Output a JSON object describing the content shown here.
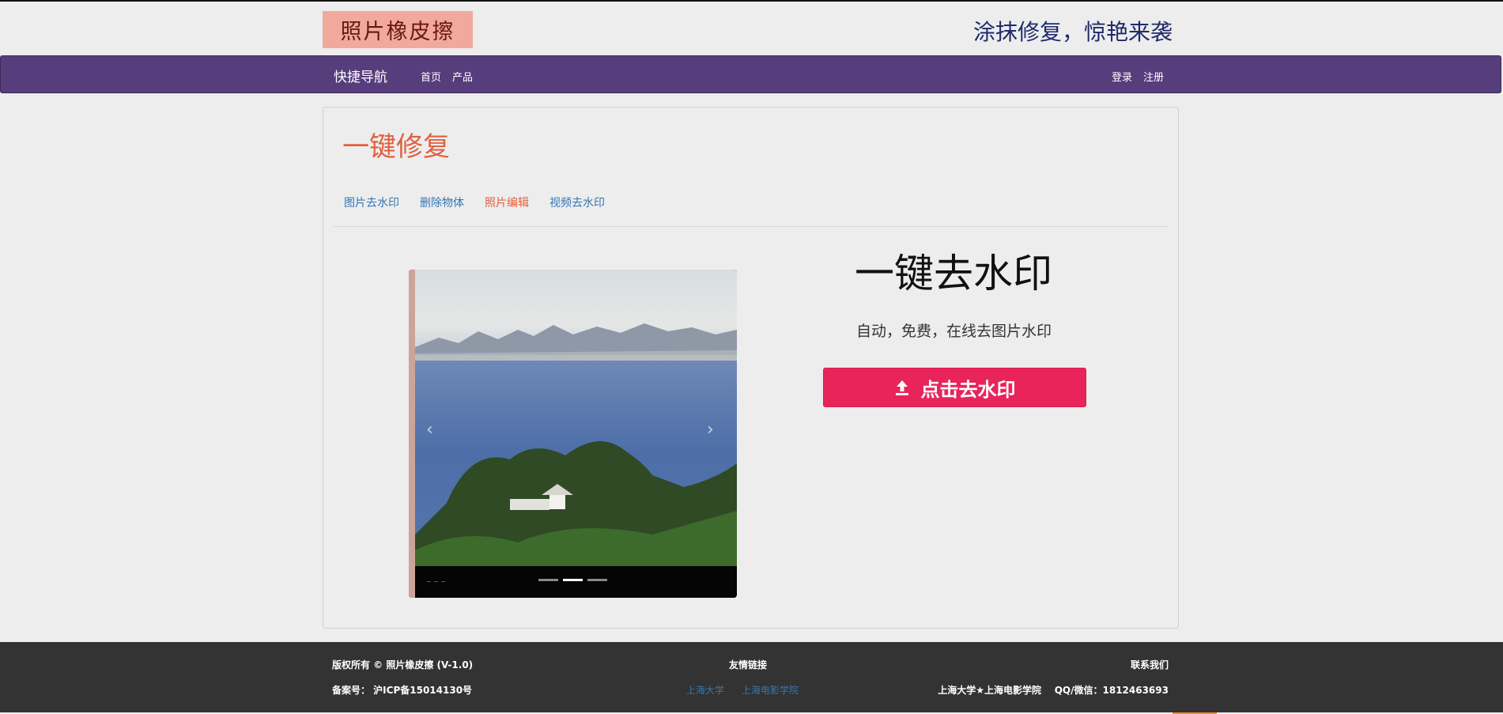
{
  "header": {
    "logo_text": "照片橡皮擦",
    "slogan": "涂抹修复，惊艳来袭"
  },
  "nav": {
    "brand": "快捷导航",
    "links": [
      "首页",
      "产品"
    ],
    "login": "登录",
    "register": "注册",
    "bar_color": "#563d7c"
  },
  "panel": {
    "title": "一键修复",
    "tabs": [
      {
        "label": "图片去水印",
        "active": false
      },
      {
        "label": "删除物体",
        "active": false
      },
      {
        "label": "照片编辑",
        "active": true
      },
      {
        "label": "视频去水印",
        "active": false
      }
    ]
  },
  "carousel": {
    "prev_icon": "‹",
    "next_icon": "›",
    "indicator_count": 3,
    "active_indicator": 2
  },
  "hero": {
    "title": "一键去水印",
    "subtitle": "自动，免费，在线去图片水印",
    "button_label": "点击去水印",
    "button_icon": "upload-icon",
    "button_color": "#e8245a"
  },
  "footer": {
    "copyright": "版权所有 © 照片橡皮擦 (V-1.0)",
    "icp": "备案号： 沪ICP备15014130号",
    "friends_title": "友情链接",
    "friend_links": [
      "上海大学",
      "上海电影学院"
    ],
    "contact_title": "联系我们",
    "contact_text": "上海大学★上海电影学院    QQ/微信：1812463693"
  }
}
